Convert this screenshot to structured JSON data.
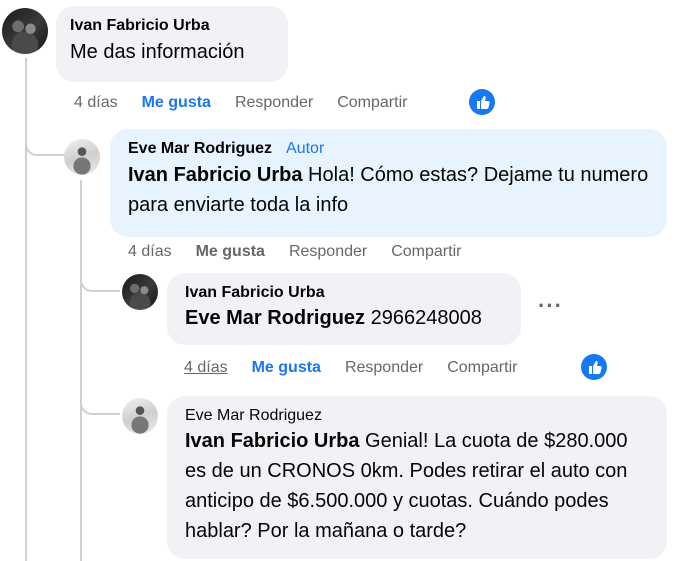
{
  "comments": [
    {
      "author": "Ivan Fabricio Urba",
      "text": "Me das información",
      "time": "4 días",
      "like_label": "Me gusta",
      "reply_label": "Responder",
      "share_label": "Compartir"
    },
    {
      "author": "Eve Mar Rodriguez",
      "badge": "Autor",
      "mention": "Ivan Fabricio Urba",
      "text": " Hola! Cómo estas? Dejame tu numero para enviarte toda la info",
      "time": "4 días",
      "like_label": "Me gusta",
      "reply_label": "Responder",
      "share_label": "Compartir"
    },
    {
      "author": "Ivan Fabricio Urba",
      "mention": "Eve Mar Rodriguez",
      "text": " 2966248008",
      "time": "4 días",
      "like_label": "Me gusta",
      "reply_label": "Responder",
      "share_label": "Compartir",
      "more": "···"
    },
    {
      "author": "Eve Mar Rodriguez",
      "mention": "Ivan Fabricio Urba",
      "text": " Genial! La cuota de $280.000 es de un CRONOS 0km. Podes retirar el auto con anticipo de $6.500.000 y cuotas. Cuándo podes hablar? Por la mañana o tarde?"
    }
  ],
  "colors": {
    "accent": "#1877f2",
    "bubble": "#f0f2f5",
    "author_bubble": "#e7f3ff",
    "meta_text": "#65676b"
  },
  "icons": [
    "thumbs-up-icon",
    "more-options-icon"
  ]
}
